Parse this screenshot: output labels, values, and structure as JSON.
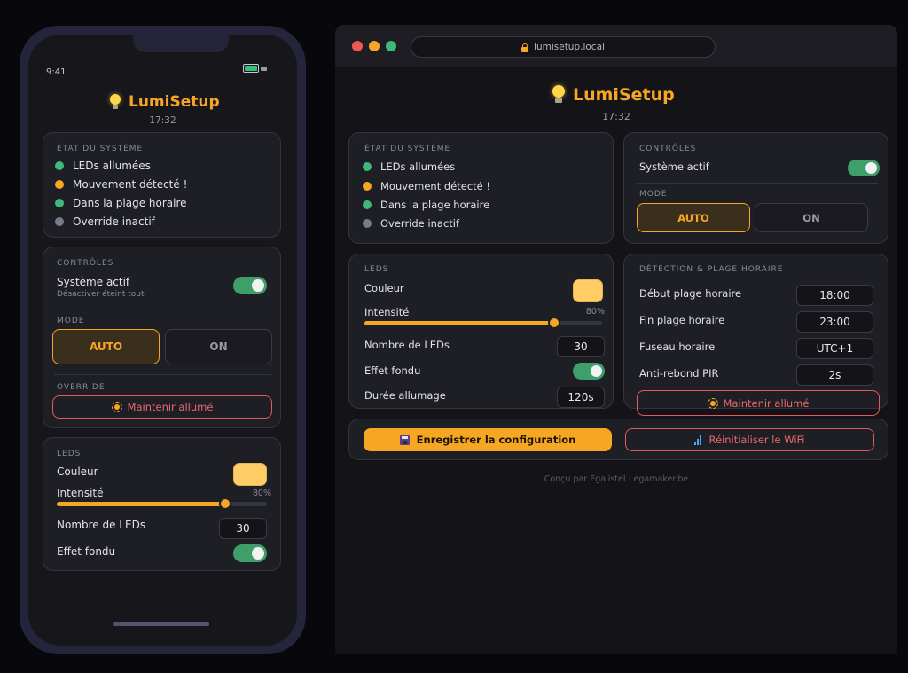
{
  "app": {
    "name": "LumiSetup",
    "time": "17:32"
  },
  "phone": {
    "status_time": "9:41"
  },
  "browser": {
    "url": "lumisetup.local"
  },
  "system_status": {
    "title": "ÉTAT DU SYSTÈME",
    "items": [
      {
        "label": "LEDs allumées",
        "color": "#3fb979"
      },
      {
        "label": "Mouvement détecté !",
        "color": "#f5a623"
      },
      {
        "label": "Dans la plage horaire",
        "color": "#3fb979"
      },
      {
        "label": "Override inactif",
        "color": "#7a7a8c"
      }
    ]
  },
  "controls": {
    "title": "CONTRÔLES",
    "system_active_label": "Système actif",
    "system_active_hint": "Désactiver éteint tout",
    "system_active": true,
    "mode_title": "MODE",
    "mode_auto": "AUTO",
    "mode_on": "ON",
    "mode_selected": "AUTO",
    "override_title": "OVERRIDE",
    "override_button": "Maintenir allumé"
  },
  "leds": {
    "title": "LEDS",
    "color_label": "Couleur",
    "color_value": "#ffcc66",
    "intensity_label": "Intensité",
    "intensity_value": "80%",
    "intensity_fraction": 0.8,
    "count_label": "Nombre de LEDs",
    "count_value": "30",
    "fade_label": "Effet fondu",
    "fade_enabled": true,
    "duration_label": "Durée allumage",
    "duration_value": "120s"
  },
  "detection": {
    "title": "DÉTECTION & PLAGE HORAIRE",
    "start_label": "Début plage horaire",
    "start_value": "18:00",
    "end_label": "Fin plage horaire",
    "end_value": "23:00",
    "timezone_label": "Fuseau horaire",
    "timezone_value": "UTC+1",
    "debounce_label": "Anti-rebond PIR",
    "debounce_value": "2s",
    "override_button": "Maintenir allumé"
  },
  "actions": {
    "save_label": "Enregistrer la configuration",
    "reset_wifi_label": "Réinitialiser le WiFi"
  },
  "footer": {
    "credit": "Conçu par Egalistel · egamaker.be"
  },
  "icons": {
    "title": "lightbulb-icon",
    "lock": "lock-icon",
    "override": "sun-icon",
    "save": "floppy-icon",
    "wifi": "wifi-icon"
  },
  "colors": {
    "accent": "#f5a623",
    "success": "#3fb979",
    "danger": "#e05a5a",
    "background": "#141418"
  }
}
